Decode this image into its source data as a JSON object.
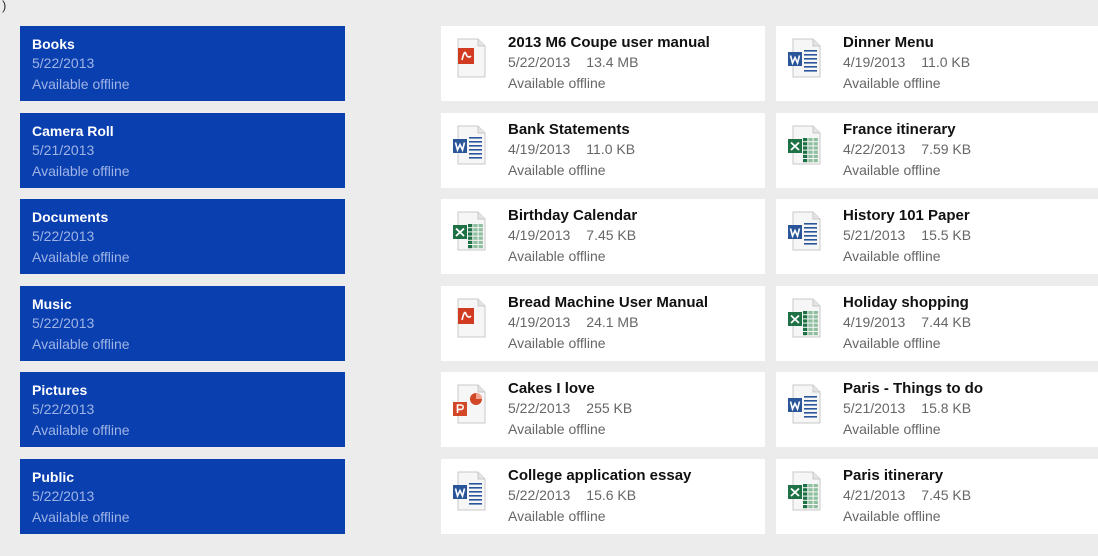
{
  "corner_mark": ")",
  "folders": [
    {
      "name": "Books",
      "date": "5/22/2013",
      "status": "Available offline"
    },
    {
      "name": "Camera Roll",
      "date": "5/21/2013",
      "status": "Available offline"
    },
    {
      "name": "Documents",
      "date": "5/22/2013",
      "status": "Available offline"
    },
    {
      "name": "Music",
      "date": "5/22/2013",
      "status": "Available offline"
    },
    {
      "name": "Pictures",
      "date": "5/22/2013",
      "status": "Available offline"
    },
    {
      "name": "Public",
      "date": "5/22/2013",
      "status": "Available offline"
    }
  ],
  "files": [
    {
      "title": "2013 M6 Coupe user manual",
      "date": "5/22/2013",
      "size": "13.4 MB",
      "status": "Available offline",
      "icon": "pdf-icon"
    },
    {
      "title": "Dinner Menu",
      "date": "4/19/2013",
      "size": "11.0 KB",
      "status": "Available offline",
      "icon": "word-icon"
    },
    {
      "title": "Bank Statements",
      "date": "4/19/2013",
      "size": "11.0 KB",
      "status": "Available offline",
      "icon": "word-icon"
    },
    {
      "title": "France itinerary",
      "date": "4/22/2013",
      "size": "7.59 KB",
      "status": "Available offline",
      "icon": "excel-icon"
    },
    {
      "title": "Birthday Calendar",
      "date": "4/19/2013",
      "size": "7.45 KB",
      "status": "Available offline",
      "icon": "excel-icon"
    },
    {
      "title": "History 101 Paper",
      "date": "5/21/2013",
      "size": "15.5 KB",
      "status": "Available offline",
      "icon": "word-icon"
    },
    {
      "title": "Bread Machine User Manual",
      "date": "4/19/2013",
      "size": "24.1 MB",
      "status": "Available offline",
      "icon": "pdf-icon"
    },
    {
      "title": "Holiday shopping",
      "date": "4/19/2013",
      "size": "7.44 KB",
      "status": "Available offline",
      "icon": "excel-icon"
    },
    {
      "title": "Cakes I love",
      "date": "5/22/2013",
      "size": "255 KB",
      "status": "Available offline",
      "icon": "powerpoint-icon"
    },
    {
      "title": "Paris - Things to do",
      "date": "5/21/2013",
      "size": "15.8 KB",
      "status": "Available offline",
      "icon": "word-icon"
    },
    {
      "title": "College application essay",
      "date": "5/22/2013",
      "size": "15.6 KB",
      "status": "Available offline",
      "icon": "word-icon"
    },
    {
      "title": "Paris itinerary",
      "date": "4/21/2013",
      "size": "7.45 KB",
      "status": "Available offline",
      "icon": "excel-icon"
    }
  ],
  "colors": {
    "folder_bg": "#0a3fb0",
    "page_bg": "#ececec",
    "pdf": "#d13b22",
    "word": "#2a5699",
    "excel": "#1e7145",
    "powerpoint": "#d24726"
  }
}
